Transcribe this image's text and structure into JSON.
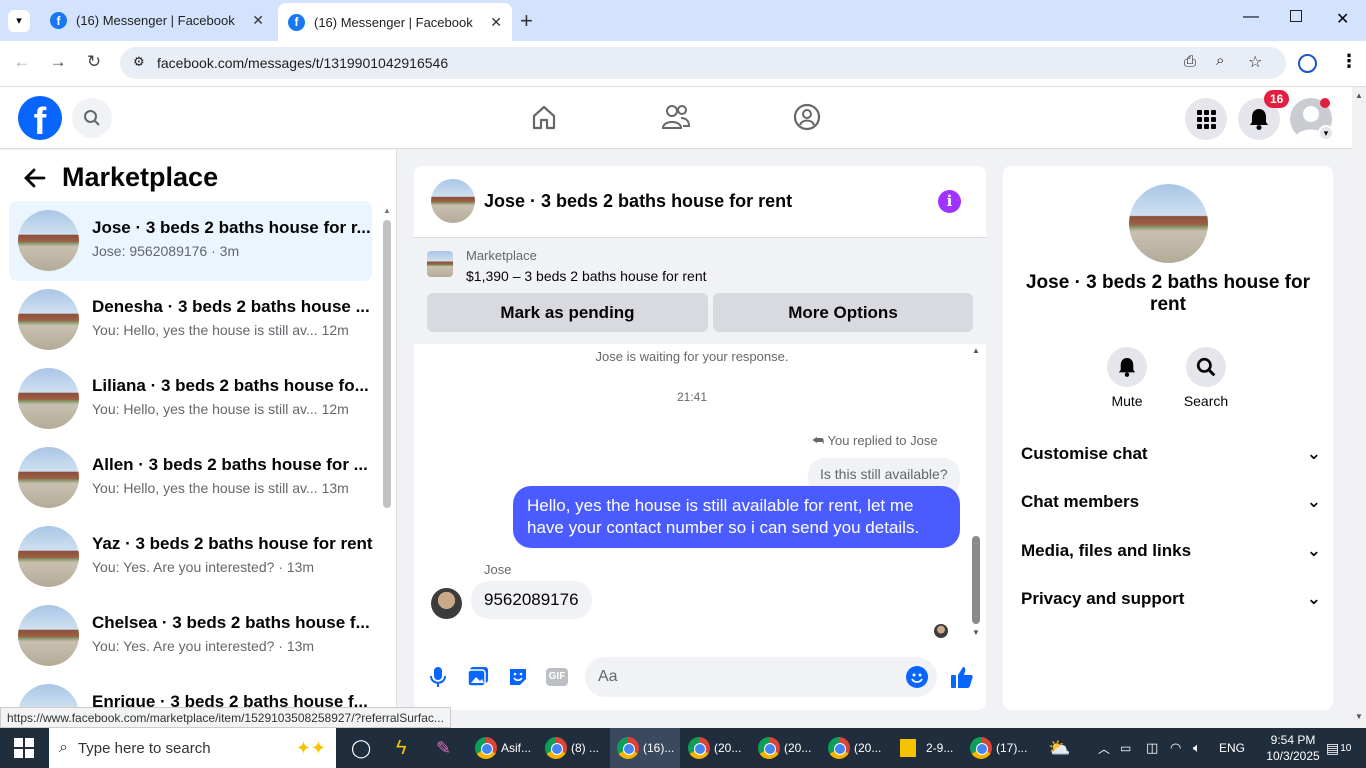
{
  "browser": {
    "tabs": [
      {
        "title": "(16) Messenger | Facebook"
      },
      {
        "title": "(16) Messenger | Facebook"
      }
    ],
    "url": "facebook.com/messages/t/1319901042916546",
    "status_url": "https://www.facebook.com/marketplace/item/1529103508258927/?referralSurfac..."
  },
  "header": {
    "notification_count": "16"
  },
  "left": {
    "title": "Marketplace",
    "conversations": [
      {
        "title": "Jose · 3 beds 2 baths house for r...",
        "sub": "Jose: 9562089176 · 3m"
      },
      {
        "title": "Denesha · 3 beds 2 baths house ...",
        "sub": "You: Hello, yes the house is still av...",
        "time": "12m"
      },
      {
        "title": "Liliana · 3 beds 2 baths house fo...",
        "sub": "You: Hello, yes the house is still av...",
        "time": "12m"
      },
      {
        "title": "Allen · 3 beds 2 baths house for ...",
        "sub": "You: Hello, yes the house is still av...",
        "time": "13m"
      },
      {
        "title": "Yaz · 3 beds 2 baths house for rent",
        "sub": "You: Yes. Are you interested? · 13m"
      },
      {
        "title": "Chelsea · 3 beds 2 baths house f...",
        "sub": "You: Yes. Are you interested? · 13m"
      },
      {
        "title": "Enrique · 3 beds 2 baths house f..."
      }
    ]
  },
  "chat": {
    "title": "Jose · 3 beds 2 baths house for rent",
    "listing_label": "Marketplace",
    "listing_price": "$1,390 – 3 beds 2 baths house for rent",
    "mark_pending": "Mark as pending",
    "more_options": "More Options",
    "waiting": "Jose is waiting for your response.",
    "timestamp": "21:41",
    "replied": "You replied to Jose",
    "quoted": "Is this still available?",
    "my_message": "Hello, yes the house is still available for rent, let me have your contact number so i can send you details.",
    "sender": "Jose",
    "their_message": "9562089176",
    "input_placeholder": "Aa"
  },
  "right": {
    "name": "Jose · 3 beds 2 baths house for rent",
    "mute": "Mute",
    "search": "Search",
    "sections": [
      "Customise chat",
      "Chat members",
      "Media, files and links",
      "Privacy and support"
    ]
  },
  "taskbar": {
    "search_placeholder": "Type here to search",
    "apps": [
      "Asif...",
      "(8) ...",
      "(16)...",
      "(20...",
      "(20...",
      "(20...",
      "2-9...",
      "(17)..."
    ],
    "lang": "ENG",
    "time": "9:54 PM",
    "date": "10/3/2025",
    "notif": "10"
  }
}
